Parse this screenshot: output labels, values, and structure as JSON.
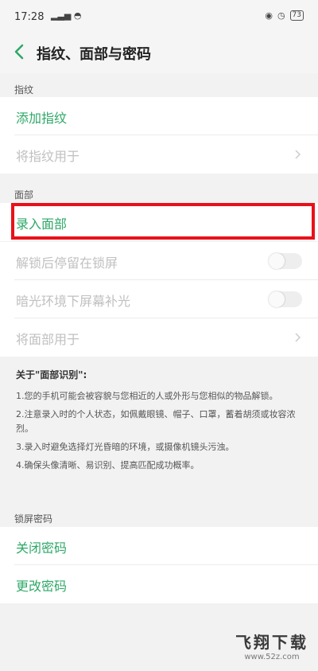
{
  "status_bar": {
    "time": "17:28",
    "signal": "▂▃▅ ◓",
    "icons": [
      "alarm-icon",
      "clock-icon"
    ],
    "battery": "73"
  },
  "header": {
    "title": "指纹、面部与密码"
  },
  "fingerprint": {
    "section_label": "指纹",
    "add_label": "添加指纹",
    "use_label": "将指纹用于"
  },
  "face": {
    "section_label": "面部",
    "enroll_label": "录入面部",
    "stay_locked_label": "解锁后停留在锁屏",
    "stay_locked_on": false,
    "dim_fill_label": "暗光环境下屏幕补光",
    "dim_fill_on": false,
    "use_label": "将面部用于"
  },
  "info": {
    "title": "关于\"面部识别\":",
    "items": [
      "1.您的手机可能会被容貌与您相近的人或外形与您相似的物品解锁。",
      "2.注意录入时的个人状态，如佩戴眼镜、帽子、口罩，蓄着胡须或妆容浓烈。",
      "3.录入时避免选择灯光昏暗的环境，或摄像机镜头污浊。",
      "4.确保头像清晰、易识别、提高匹配成功概率。"
    ]
  },
  "lock_password": {
    "section_label": "锁屏密码",
    "close_label": "关闭密码",
    "change_label": "更改密码"
  },
  "watermark": {
    "name": "飞翔下载",
    "url": "www.52z.com"
  },
  "colors": {
    "accent_green": "#2ea867",
    "highlight_red": "#e8111a",
    "background": "#f2f2f2"
  }
}
